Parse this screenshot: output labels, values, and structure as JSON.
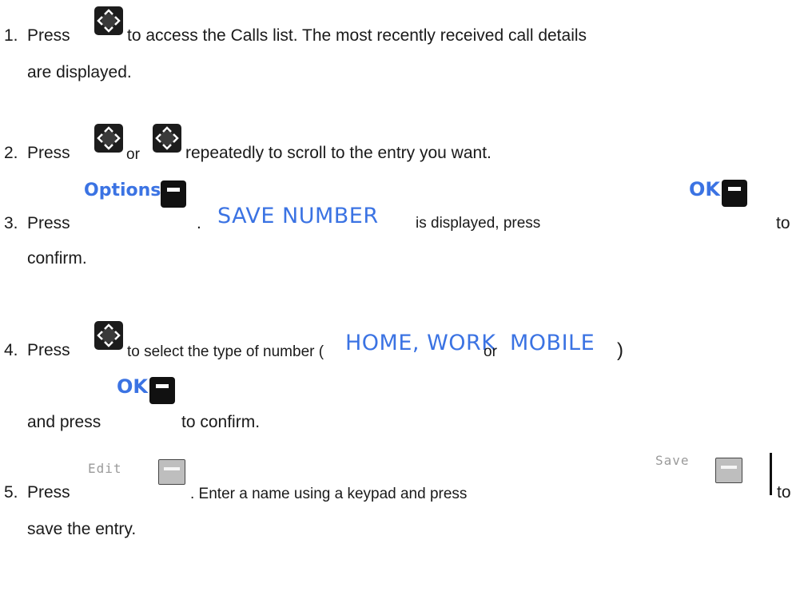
{
  "steps": [
    {
      "num": "1.",
      "press": "Press",
      "text1": "to access the Calls list.  The most recently received call details",
      "text2": "are displayed."
    },
    {
      "num": "2.",
      "press": "Press",
      "or": "or",
      "text1": "repeatedly to scroll to the entry you want."
    },
    {
      "num": "3.",
      "press": "Press",
      "options_label": "Options",
      "period": ".",
      "save_number": "SAVE NUMBER",
      "mid": "is displayed, press",
      "ok_label": "OK",
      "to": "to",
      "text2": "confirm."
    },
    {
      "num": "4.",
      "press": "Press",
      "text1": "to select the type of number (",
      "home_work": "HOME, WORK",
      "or": "or",
      "mobile": "MOBILE",
      "close_paren": ")",
      "text2_pre": "and press",
      "ok_label": "OK",
      "text2_post": "to confirm."
    },
    {
      "num": "5.",
      "press": "Press",
      "edit_label": "Edit",
      "text1": ". Enter a name using a keypad and press",
      "save_label": "Save",
      "to": "to",
      "text2": "save the entry."
    }
  ],
  "icons": {
    "nav": "navigation-key-icon",
    "softkey": "softkey-icon"
  },
  "colors": {
    "display_text": "#3b73e3",
    "body_text": "#1a1a1a"
  }
}
